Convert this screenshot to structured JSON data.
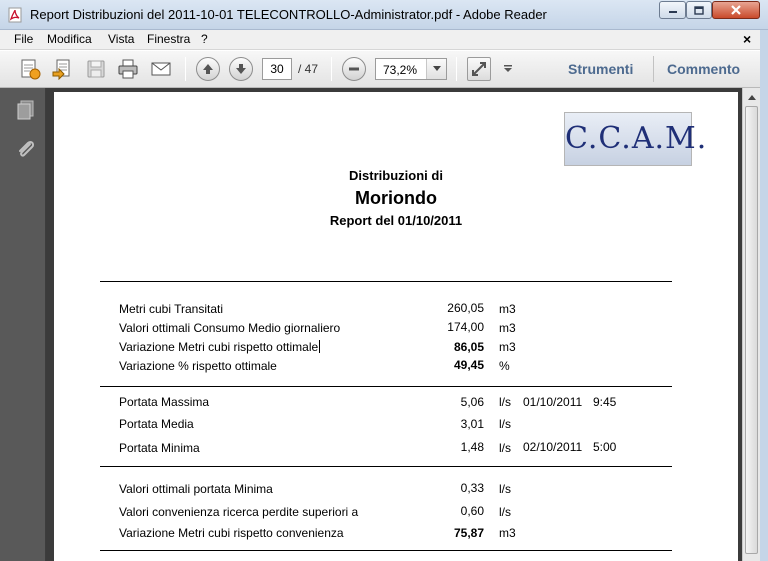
{
  "window": {
    "title": "Report Distribuzioni del 2011-10-01 TELECONTROLLO-Administrator.pdf - Adobe Reader"
  },
  "menu": {
    "items": [
      {
        "label": "File"
      },
      {
        "label": "Modifica"
      },
      {
        "label": "Vista"
      },
      {
        "label": "Finestra"
      },
      {
        "label": "?"
      }
    ],
    "close_label": "×"
  },
  "toolbar": {
    "page_current": "30",
    "page_total": "/ 47",
    "zoom": "73,2%",
    "tools_label": "Strumenti",
    "comment_label": "Commento"
  },
  "report": {
    "logo_text": "C.C.A.M.",
    "heading": "Distribuzioni di",
    "location": "Moriondo",
    "subtitle": "Report del 01/10/2011",
    "section1": [
      {
        "label": "Metri cubi Transitati",
        "value": "260,05",
        "unit": "m3"
      },
      {
        "label": "Valori ottimali Consumo Medio giornaliero",
        "value": "174,00",
        "unit": "m3"
      },
      {
        "label": "Variazione Metri cubi rispetto ottimale",
        "value": "86,05",
        "unit": "m3"
      },
      {
        "label": "Variazione % rispetto ottimale",
        "value": "49,45",
        "unit": "%"
      }
    ],
    "section2": [
      {
        "label": "Portata Massima",
        "value": "5,06",
        "unit": "l/s",
        "date": "01/10/2011",
        "time": "9:45"
      },
      {
        "label": "Portata Media",
        "value": "3,01",
        "unit": "l/s"
      },
      {
        "label": "Portata Minima",
        "value": "1,48",
        "unit": "l/s",
        "date": "02/10/2011",
        "time": "5:00"
      }
    ],
    "section3": [
      {
        "label": "Valori ottimali portata Minima",
        "value": "0,33",
        "unit": "l/s"
      },
      {
        "label": "Valori convenienza ricerca perdite superiori a",
        "value": "0,60",
        "unit": "l/s"
      },
      {
        "label": "Variazione Metri cubi rispetto convenienza",
        "value": "75,87",
        "unit": "m3"
      }
    ]
  }
}
